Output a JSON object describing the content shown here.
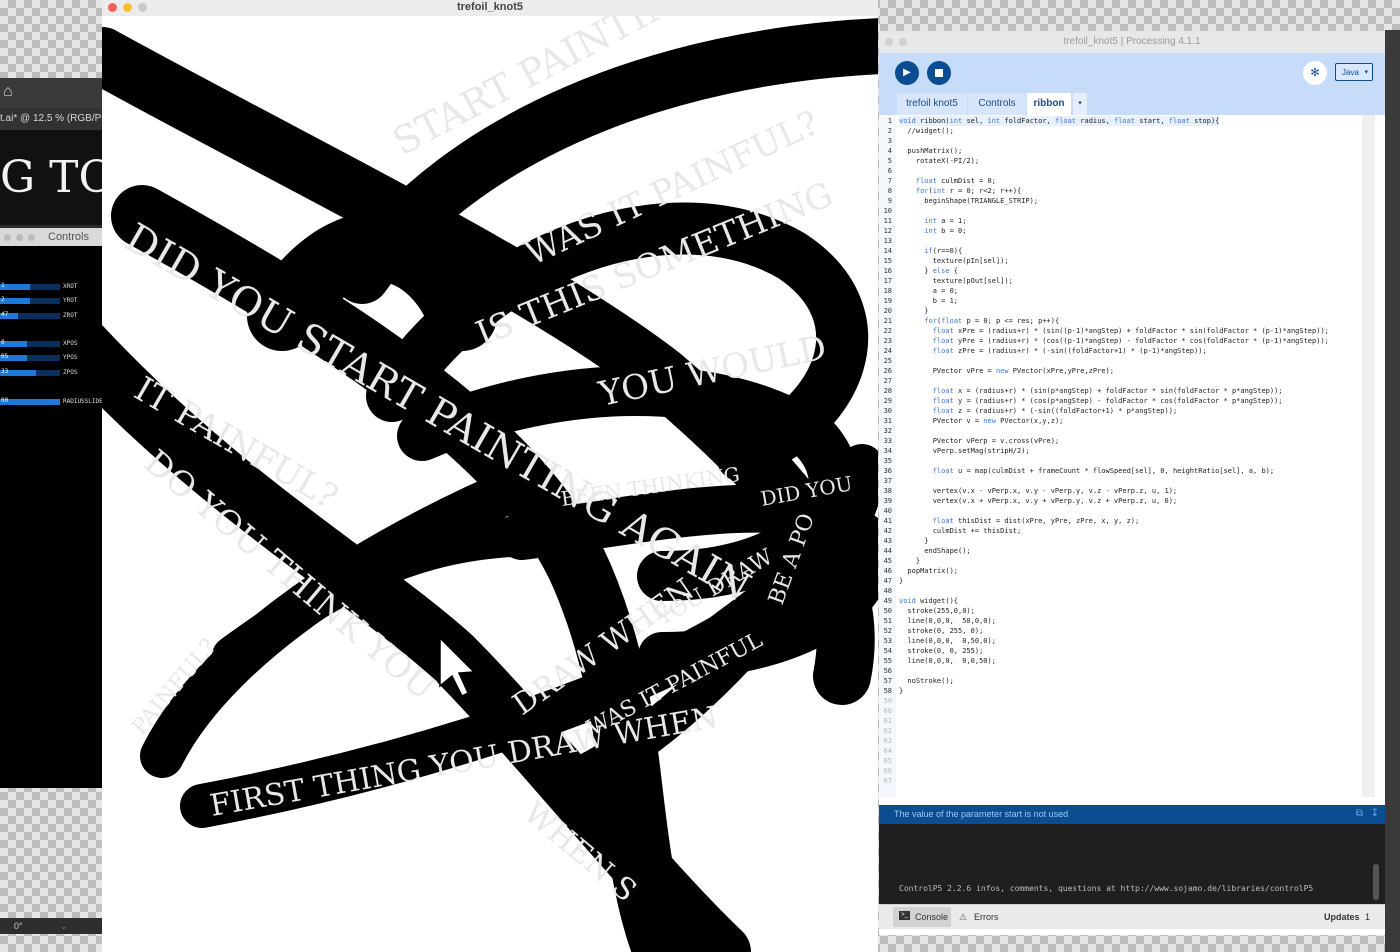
{
  "illustrator": {
    "doc_tab": "t.ai* @ 12.5 % (RGB/Pr",
    "artboard_text": "G TO",
    "bottom_field": "0°"
  },
  "controls_window": {
    "title": "Controls",
    "sliders": [
      {
        "label": "XROT",
        "value": "1",
        "fraction": 0.5
      },
      {
        "label": "YROT",
        "value": "2",
        "fraction": 0.5
      },
      {
        "label": "ZROT",
        "value": "47",
        "fraction": 0.3
      },
      {
        "label": "XPOS",
        "value": "0",
        "fraction": 0.45
      },
      {
        "label": "YPOS",
        "value": "05",
        "fraction": 0.45
      },
      {
        "label": "ZPOS",
        "value": "33",
        "fraction": 0.6
      },
      {
        "label": "RADIUSSLIDER",
        "value": "00",
        "fraction": 1.0
      }
    ]
  },
  "sketch_window": {
    "title": "trefoil_knot5",
    "ribbon_texts": [
      "START PAINTING AGAIN",
      "DID YOU START PAINTING AGAIN",
      "WAS IT PAINFUL?",
      "IS THIS SOMETHING",
      "YOU WOULD",
      "IT PAINFUL?",
      "FIRST THING YOU DRAW WHEN",
      "DRAW WHEN",
      "DO YOU THINK YOU",
      "BEEN THINKING",
      "DID YOU",
      "WAS IT PAINFUL",
      "YOU DRAW",
      "PAINFUL?",
      "WHEN S",
      "BE A PO"
    ]
  },
  "ide": {
    "title": "trefoil_knot5 | Processing 4.1.1",
    "mode": "Java",
    "tabs": [
      "trefoil knot5",
      "Controls",
      "ribbon"
    ],
    "active_tab": "ribbon",
    "code_lines": [
      "void ribbon(int sel, int foldFactor, float radius, float start, float stop){",
      "  //widget();",
      "",
      "  pushMatrix();",
      "    rotateX(-PI/2);",
      "",
      "    float culmDist = 0;",
      "    for(int r = 0; r<2; r++){",
      "      beginShape(TRIANGLE_STRIP);",
      "",
      "      int a = 1;",
      "      int b = 0;",
      "",
      "      if(r==0){",
      "        texture(pIn[sel]);",
      "      } else {",
      "        texture(pOut[sel]);",
      "        a = 0;",
      "        b = 1;",
      "      }",
      "      for(float p = 0; p <= res; p++){",
      "        float xPre = (radius+r) * (sin((p-1)*angStep) + foldFactor * sin(foldFactor * (p-1)*angStep));",
      "        float yPre = (radius+r) * (cos((p-1)*angStep) - foldFactor * cos(foldFactor * (p-1)*angStep));",
      "        float zPre = (radius+r) * (-sin((foldFactor+1) * (p-1)*angStep));",
      "",
      "        PVector vPre = new PVector(xPre,yPre,zPre);",
      "",
      "        float x = (radius+r) * (sin(p*angStep) + foldFactor * sin(foldFactor * p*angStep));",
      "        float y = (radius+r) * (cos(p*angStep) - foldFactor * cos(foldFactor * p*angStep));",
      "        float z = (radius+r) * (-sin((foldFactor+1) * p*angStep));",
      "        PVector v = new PVector(x,y,z);",
      "",
      "        PVector vPerp = v.cross(vPre);",
      "        vPerp.setMag(stripH/2);",
      "",
      "        float u = map(culmDist + frameCount * flowSpeed[sel], 0, heightRatio[sel], a, b);",
      "",
      "        vertex(v.x - vPerp.x, v.y - vPerp.y, v.z - vPerp.z, u, 1);",
      "        vertex(v.x + vPerp.x, v.y + vPerp.y, v.z + vPerp.z, u, 0);",
      "",
      "        float thisDist = dist(xPre, yPre, zPre, x, y, z);",
      "        culmDist += thisDist;",
      "      }",
      "      endShape();",
      "    }",
      "  popMatrix();",
      "}",
      "",
      "void widget(){",
      "  stroke(255,0,0);",
      "  line(0,0,0,  50,0,0);",
      "  stroke(0, 255, 0);",
      "  line(0,0,0,  0,50,0);",
      "  stroke(0, 0, 255);",
      "  line(0,0,0,  0,0,50);",
      "",
      "  noStroke();",
      "}",
      "",
      "",
      "",
      "",
      "",
      "",
      "",
      "",
      ""
    ],
    "error_message": "The value of the parameter start is not used",
    "console_output": "ControlP5 2.2.6 infos, comments, questions at http://www.sojamo.de/libraries/controlP5",
    "footer": {
      "console_label": "Console",
      "errors_label": "Errors",
      "updates_label": "Updates",
      "updates_count": "1"
    }
  },
  "colors": {
    "ide_accent": "#0c4d92",
    "toolbar_bg": "#c6dcf8",
    "slider_fill": "#1d78d8"
  }
}
